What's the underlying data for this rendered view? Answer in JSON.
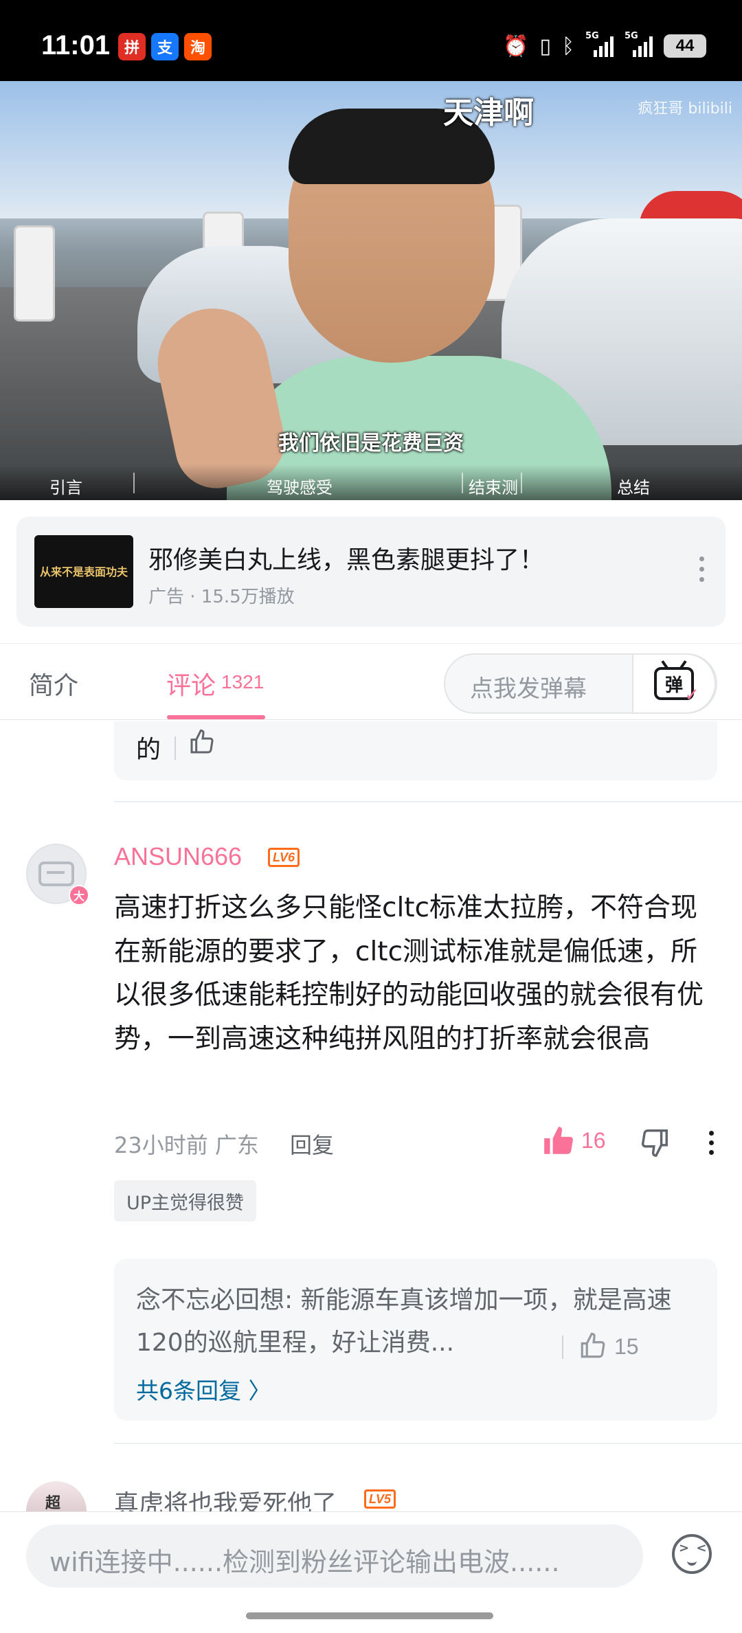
{
  "status_bar": {
    "time": "11:01",
    "apps": [
      {
        "icon": "pinduoduo-app-icon",
        "glyph": "拼",
        "color": "#e02e24"
      },
      {
        "icon": "alipay-app-icon",
        "glyph": "支",
        "color": "#1677ff"
      },
      {
        "icon": "taobao-app-icon",
        "glyph": "淘",
        "color": "#ff5000"
      }
    ],
    "network_1": "5G",
    "network_2": "5G",
    "battery": "44"
  },
  "video": {
    "title_overlay": "天津啊",
    "watermark": "疯狂哥 bilibili",
    "subtitle": "我们依旧是花费巨资",
    "chapters": [
      "引言",
      "驾驶感受",
      "结束测",
      "总结"
    ]
  },
  "ad": {
    "thumb_text": "从来不是表面功夫",
    "title": "邪修美白丸上线，黑色素腿更抖了！",
    "meta": "广告 · 15.5万播放"
  },
  "tabs": {
    "intro": "简介",
    "comments": "评论",
    "comments_count": "1321",
    "danmaku_placeholder": "点我发弹幕",
    "danmaku_button": "弹"
  },
  "prev_comment": {
    "tail_text": "的"
  },
  "comment": {
    "avatar_badge": "大",
    "username": "ANSUN666",
    "level": "LV6",
    "text": "高速打折这么多只能怪cltc标准太拉胯，不符合现在新能源的要求了，cltc测试标准就是偏低速，所以很多低速能耗控制好的动能回收强的就会很有优势，一到高速这种纯拼风阻的打折率就会很高",
    "time_location": "23小时前  广东",
    "reply_label": "回复",
    "likes": "16",
    "up_badge": "UP主觉得很赞",
    "sub_reply": {
      "text": "念不忘必回想: 新能源车真该增加一项，就是高速120的巡航里程，好让消费...",
      "likes": "15",
      "more": "共6条回复 〉"
    }
  },
  "next_comment": {
    "avatar_text": "超",
    "username": "真虎将也我爱死他了",
    "level": "LV5"
  },
  "bottom_bar": {
    "placeholder": "wifi连接中......检测到粉丝评论输出电波......"
  },
  "colors": {
    "accent": "#fb7299",
    "level_orange": "#ff6b1a",
    "link_blue": "#00699d"
  }
}
